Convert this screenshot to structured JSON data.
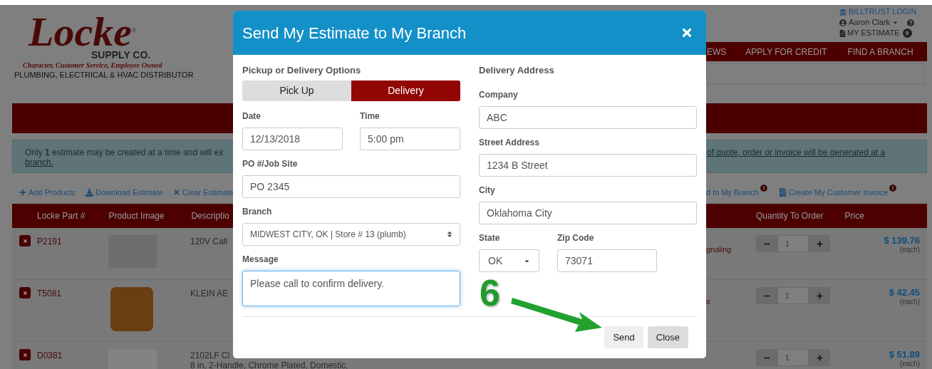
{
  "header": {
    "logo": {
      "name": "Locke",
      "mark": "®",
      "subtitle": "SUPPLY CO.",
      "tagline": "Character, Customer Service, Employee Owned"
    },
    "slogan": "PLUMBING, ELECTRICAL & HVAC DISTRIBUTOR",
    "top_links": {
      "billtrust": "BILLTRUST LOGIN",
      "user": "Aaron Clark",
      "estimate": {
        "label": "MY ESTIMATE",
        "count": "5"
      }
    },
    "nav": [
      "EWS",
      "APPLY FOR CREDIT",
      "FIND A BRANCH"
    ]
  },
  "notice": {
    "text": "Only **1** estimate may be created at a time and will ex",
    "link_left": "branch.",
    "link_right": "of quote, order or invoice will be generated at a"
  },
  "actions_left": [
    {
      "kind": "add",
      "label": "Add Products"
    },
    {
      "kind": "download",
      "label": "Download Estimate"
    },
    {
      "kind": "clear",
      "label": "Clear Estimate"
    }
  ],
  "actions_right": [
    {
      "kind": "send",
      "label": "d to My Branch",
      "info": true
    },
    {
      "kind": "invoice",
      "label": "Create My Customer Invoice",
      "info": true
    }
  ],
  "table": {
    "columns_left": [
      "Locke Part #",
      "Product Image",
      "Descriptio"
    ],
    "columns_right": [
      "Quantity To Order",
      "Price"
    ],
    "rows": [
      {
        "part": "P2191",
        "description": [
          "120V Call"
        ],
        "category": "gnaling",
        "quantity": "1",
        "price": "$ 139.76",
        "unit": "(each)"
      },
      {
        "part": "T5081",
        "description": [
          "KLEIN AE"
        ],
        "category": "s",
        "quantity": "1",
        "price": "$ 42.45",
        "unit": "(each)"
      },
      {
        "part": "D0381",
        "description": [
          "2102LF Cl",
          "8 in, 2-Handle, Chrome Plated, Domestic,"
        ],
        "quantity": "1",
        "price": "$ 51.89",
        "unit": "(each)"
      }
    ]
  },
  "modal": {
    "title": "Send My Estimate to My Branch",
    "left": {
      "heading": "Pickup or Delivery Options",
      "options": [
        {
          "label": "Pick Up",
          "selected": false
        },
        {
          "label": "Delivery",
          "selected": true
        }
      ],
      "date": {
        "label": "Date",
        "value": "12/13/2018"
      },
      "time": {
        "label": "Time",
        "value": "5:00 pm"
      },
      "po": {
        "label": "PO #/Job Site",
        "value": "PO 2345"
      },
      "branch": {
        "label": "Branch",
        "value": "MIDWEST CITY, OK | Store # 13 (plumb)"
      },
      "message": {
        "label": "Message",
        "value": "Please call to confirm delivery.",
        "focused": true
      }
    },
    "right": {
      "heading": "Delivery Address",
      "company": {
        "label": "Company",
        "value": "ABC"
      },
      "street": {
        "label": "Street Address",
        "value": "1234 B Street"
      },
      "city": {
        "label": "City",
        "value": "Oklahoma City"
      },
      "state": {
        "label": "State",
        "value": "OK"
      },
      "zip": {
        "label": "Zip Code",
        "value": "73071"
      }
    },
    "buttons": [
      "Send",
      "Close"
    ],
    "annotation": "6"
  }
}
